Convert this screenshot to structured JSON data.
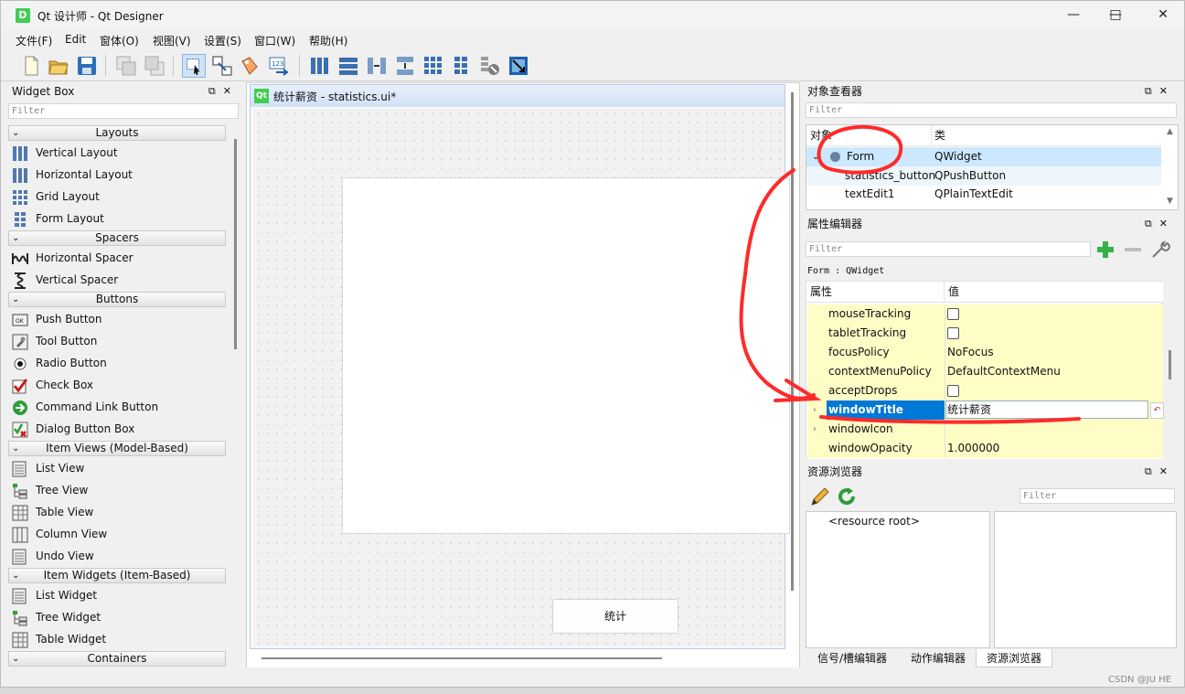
{
  "window": {
    "title": "Qt 设计师 - Qt Designer",
    "app_icon": "D"
  },
  "menu": [
    "文件(F)",
    "Edit",
    "窗体(O)",
    "视图(V)",
    "设置(S)",
    "窗口(W)",
    "帮助(H)"
  ],
  "widget_box": {
    "title": "Widget Box",
    "filter_placeholder": "Filter",
    "categories": {
      "layouts": "Layouts",
      "spacers": "Spacers",
      "buttons": "Buttons",
      "item_views": "Item Views (Model-Based)",
      "item_widgets": "Item Widgets (Item-Based)",
      "containers": "Containers"
    },
    "items": {
      "vertical_layout": "Vertical Layout",
      "horizontal_layout": "Horizontal Layout",
      "grid_layout": "Grid Layout",
      "form_layout": "Form Layout",
      "horizontal_spacer": "Horizontal Spacer",
      "vertical_spacer": "Vertical Spacer",
      "push_button": "Push Button",
      "tool_button": "Tool Button",
      "radio_button": "Radio Button",
      "check_box": "Check Box",
      "command_link_button": "Command Link Button",
      "dialog_button_box": "Dialog Button Box",
      "list_view": "List View",
      "tree_view": "Tree View",
      "table_view": "Table View",
      "column_view": "Column View",
      "undo_view": "Undo View",
      "list_widget": "List Widget",
      "tree_widget": "Tree Widget",
      "table_widget": "Table Widget"
    }
  },
  "form": {
    "subwindow_icon": "Qt",
    "subwindow_title": "统计薪资 - statistics.ui*",
    "button_label": "统计"
  },
  "object_inspector": {
    "title": "对象查看器",
    "filter_placeholder": "Filter",
    "col_object": "对象",
    "col_class": "类",
    "rows": [
      {
        "name": "Form",
        "cls": "QWidget"
      },
      {
        "name": "statistics_button",
        "cls": "QPushButton"
      },
      {
        "name": "textEdit1",
        "cls": "QPlainTextEdit"
      }
    ]
  },
  "property_editor": {
    "title": "属性编辑器",
    "filter_placeholder": "Filter",
    "context": "Form : QWidget",
    "col_property": "属性",
    "col_value": "值",
    "rows": [
      {
        "name": "mouseTracking",
        "value": ""
      },
      {
        "name": "tabletTracking",
        "value": ""
      },
      {
        "name": "focusPolicy",
        "value": "NoFocus"
      },
      {
        "name": "contextMenuPolicy",
        "value": "DefaultContextMenu"
      },
      {
        "name": "acceptDrops",
        "value": ""
      },
      {
        "name": "windowTitle",
        "value": "统计薪资"
      },
      {
        "name": "windowIcon",
        "value": ""
      },
      {
        "name": "windowOpacity",
        "value": "1.000000"
      }
    ]
  },
  "resource_browser": {
    "title": "资源浏览器",
    "filter_placeholder": "Filter",
    "root": "<resource root>"
  },
  "bottom_tabs": [
    "信号/槽编辑器",
    "动作编辑器",
    "资源浏览器"
  ],
  "watermark": "CSDN @JU HE",
  "colors": {
    "annotation": "#ff2a2a",
    "selection": "#0078d7",
    "property_row": "#fffdc6"
  }
}
